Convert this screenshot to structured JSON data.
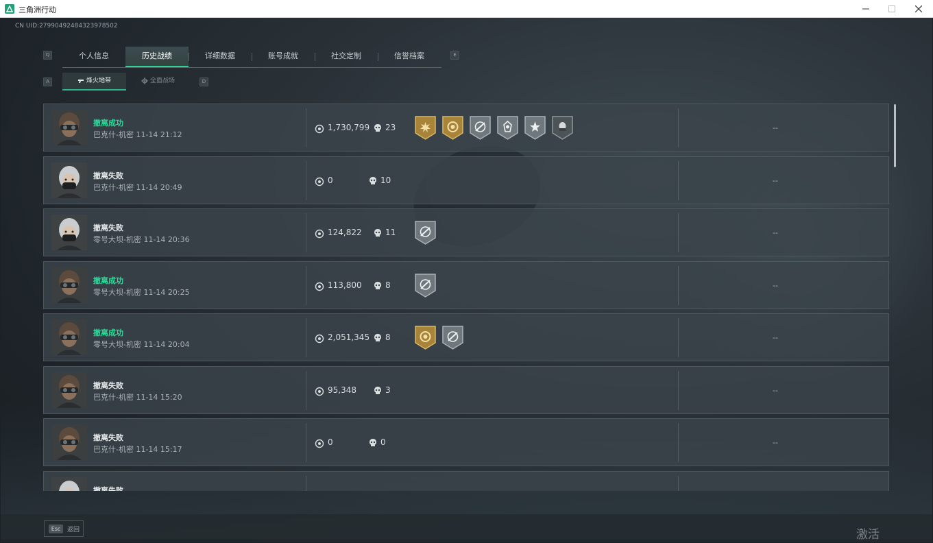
{
  "window": {
    "title": "三角洲行动"
  },
  "header": {
    "uid": "CN UID:27990492484323978502",
    "tab_key_left": "Q",
    "tab_key_right": "E",
    "subtab_key_left": "A",
    "subtab_key_right": "D",
    "tabs": [
      {
        "label": "个人信息",
        "active": false
      },
      {
        "label": "历史战绩",
        "active": true
      },
      {
        "label": "详细数据",
        "active": false
      },
      {
        "label": "账号成就",
        "active": false
      },
      {
        "label": "社交定制",
        "active": false
      },
      {
        "label": "信誉档案",
        "active": false
      }
    ],
    "subtabs": [
      {
        "label": "烽火地带",
        "active": true,
        "icon": "gun-icon"
      },
      {
        "label": "全面战场",
        "active": false,
        "icon": "crosshair-icon"
      }
    ]
  },
  "matches": [
    {
      "status": "撤离成功",
      "success": true,
      "detail": "巴克什-机密 11-14 21:12",
      "value": "1,730,799",
      "kills": "23",
      "avatar": "goggles",
      "badges": [
        "gold-burst",
        "gold-coin",
        "silver-strike",
        "silver-emblem",
        "silver-star",
        "dark-head"
      ],
      "extra": "--"
    },
    {
      "status": "撤离失败",
      "success": false,
      "detail": "巴克什-机密 11-14 20:49",
      "value": "0",
      "kills": "10",
      "avatar": "masked",
      "badges": [],
      "extra": "--"
    },
    {
      "status": "撤离失败",
      "success": false,
      "detail": "零号大坝-机密 11-14 20:36",
      "value": "124,822",
      "kills": "11",
      "avatar": "masked",
      "badges": [
        "silver-strike"
      ],
      "extra": "--"
    },
    {
      "status": "撤离成功",
      "success": true,
      "detail": "零号大坝-机密 11-14 20:25",
      "value": "113,800",
      "kills": "8",
      "avatar": "goggles",
      "badges": [
        "silver-strike"
      ],
      "extra": "--"
    },
    {
      "status": "撤离成功",
      "success": true,
      "detail": "零号大坝-机密 11-14 20:04",
      "value": "2,051,345",
      "kills": "8",
      "avatar": "goggles",
      "badges": [
        "gold-coin",
        "silver-strike"
      ],
      "extra": "--"
    },
    {
      "status": "撤离失败",
      "success": false,
      "detail": "巴克什-机密 11-14 15:20",
      "value": "95,348",
      "kills": "3",
      "avatar": "goggles",
      "badges": [],
      "extra": "--"
    },
    {
      "status": "撤离失败",
      "success": false,
      "detail": "巴克什-机密 11-14 15:17",
      "value": "0",
      "kills": "0",
      "avatar": "goggles",
      "badges": [],
      "extra": "--"
    },
    {
      "status": "撤离失败",
      "success": false,
      "detail": "",
      "value": "",
      "kills": "",
      "avatar": "masked",
      "badges": [],
      "extra": ""
    }
  ],
  "footer": {
    "esc_key": "Esc",
    "back_label": "返回",
    "watermark": "激活 Windows"
  },
  "colors": {
    "accent": "#2ed89a",
    "row_bg": "#3a444a",
    "gold_badge": "#a8843a",
    "silver_badge": "#8f989c"
  }
}
